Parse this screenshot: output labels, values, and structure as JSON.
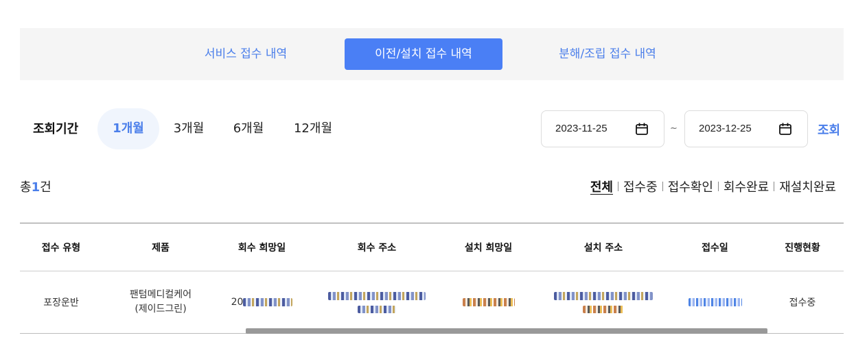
{
  "tabs": [
    {
      "label": "서비스 접수 내역",
      "active": false
    },
    {
      "label": "이전/설치 접수 내역",
      "active": true
    },
    {
      "label": "분해/조립 접수 내역",
      "active": false
    }
  ],
  "period": {
    "label": "조회기간",
    "options": [
      "1개월",
      "3개월",
      "6개월",
      "12개월"
    ],
    "selected": "1개월",
    "start_date": "2023-11-25",
    "end_date": "2023-12-25",
    "separator": "~",
    "search_label": "조회"
  },
  "summary": {
    "prefix": "총",
    "count": "1",
    "suffix": "건"
  },
  "filters": [
    "전체",
    "접수중",
    "접수확인",
    "회수완료",
    "재설치완료"
  ],
  "active_filter": "전체",
  "table": {
    "headers": [
      "접수 유형",
      "제품",
      "회수 희망일",
      "회수 주소",
      "설치 희망일",
      "설치 주소",
      "접수일",
      "진행현황"
    ],
    "rows": [
      {
        "type": "포장운반",
        "product_line1": "팬텀메디컬케어",
        "product_line2": "(제이드그린)",
        "pickup_date_prefix": "20",
        "status": "접수중"
      }
    ]
  },
  "colors": {
    "accent": "#4a7ff5",
    "link": "#4a7eea",
    "tab_bg": "#f5f5f5"
  }
}
